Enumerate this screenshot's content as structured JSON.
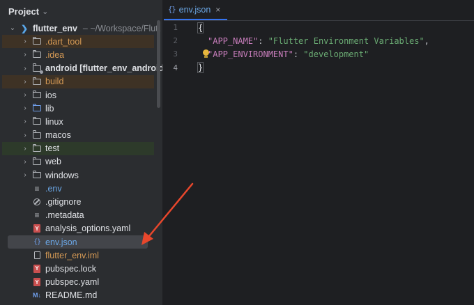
{
  "project_header": {
    "title": "Project",
    "chevron": "chevron-down-icon"
  },
  "tree": {
    "root": {
      "name": "flutter_env",
      "path": "~/Workspace/Flutt"
    },
    "items": [
      {
        "label": ".dart_tool",
        "type": "folder",
        "status": "ignored"
      },
      {
        "label": ".idea",
        "type": "folder",
        "status": "ignored"
      },
      {
        "label": "android [flutter_env_android]",
        "type": "folder",
        "status": "bold"
      },
      {
        "label": "build",
        "type": "folder",
        "status": "ignored"
      },
      {
        "label": "ios",
        "type": "folder",
        "status": "normal"
      },
      {
        "label": "lib",
        "type": "folder-blue",
        "status": "normal"
      },
      {
        "label": "linux",
        "type": "folder",
        "status": "normal"
      },
      {
        "label": "macos",
        "type": "folder",
        "status": "normal"
      },
      {
        "label": "test",
        "type": "folder",
        "status": "normal"
      },
      {
        "label": "web",
        "type": "folder",
        "status": "normal"
      },
      {
        "label": "windows",
        "type": "folder",
        "status": "normal"
      },
      {
        "label": ".env",
        "type": "file-lines",
        "status": "added"
      },
      {
        "label": ".gitignore",
        "type": "file-ignore",
        "status": "normal"
      },
      {
        "label": ".metadata",
        "type": "file-lines",
        "status": "normal"
      },
      {
        "label": "analysis_options.yaml",
        "type": "file-yaml",
        "status": "normal"
      },
      {
        "label": "env.json",
        "type": "file-json",
        "status": "added-selected"
      },
      {
        "label": "flutter_env.iml",
        "type": "file-iml",
        "status": "ignored"
      },
      {
        "label": "pubspec.lock",
        "type": "file-yaml",
        "status": "normal"
      },
      {
        "label": "pubspec.yaml",
        "type": "file-yaml",
        "status": "normal"
      },
      {
        "label": "README.md",
        "type": "file-md",
        "status": "normal"
      }
    ]
  },
  "editor": {
    "tab": {
      "label": "env.json",
      "close": "×"
    },
    "line_numbers": [
      "1",
      "2",
      "3",
      "4"
    ],
    "lines": [
      {
        "open": "{"
      },
      {
        "key": "\"APP_NAME\"",
        "sep": ": ",
        "value": "\"Flutter Environment Variables\"",
        "end": ","
      },
      {
        "key": "\"APP_ENVIRONMENT\"",
        "sep": ": ",
        "value": "\"development\""
      },
      {
        "close": "}"
      }
    ]
  },
  "colors": {
    "sidebar_bg": "#2b2d30",
    "editor_bg": "#1e1f22",
    "accent": "#3574f0",
    "ignored_text": "#d69a55",
    "added_text": "#6ba7e6",
    "annotation_arrow": "#e8472c"
  }
}
